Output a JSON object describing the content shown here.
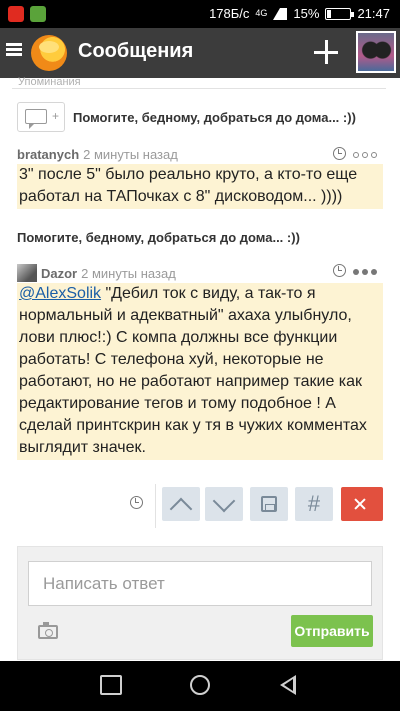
{
  "status_bar": {
    "network": "178Б/с",
    "net_type": "4G",
    "battery": "15%",
    "time": "21:47"
  },
  "app_bar": {
    "title": "Сообщения"
  },
  "mentions_header": "Упоминания",
  "thread": {
    "title": "Помогите, бедному, добраться до дома... :))"
  },
  "comments": [
    {
      "author": "bratanych",
      "time": "2 минуты назад",
      "text": "3\" после 5\" было реально круто, а кто-то еще работал на ТАПочках с 8\" дисководом... ))))"
    },
    {
      "author": "Dazor",
      "time": "2 минуты назад",
      "mention": "@AlexSolik",
      "text": " \"Дебил ток с виду, а так-то я нормальный и адекватный\" ахаха улыбнуло, лови плюс!:) С компа должны все функции работать! С телефона хуй, некоторые не работают, но не работают например такие как редактирование тегов и тому подобное ! А сделай принтскрин как у тя в чужих комментах выглядит значек."
    }
  ],
  "actions": {
    "hash_label": "#"
  },
  "reply": {
    "placeholder": "Написать ответ",
    "send_label": "Отправить"
  },
  "colors": {
    "app_bar": "#3c3c3c",
    "highlight": "#fdf3d3",
    "send": "#7cc24e",
    "delete": "#e2503e"
  }
}
